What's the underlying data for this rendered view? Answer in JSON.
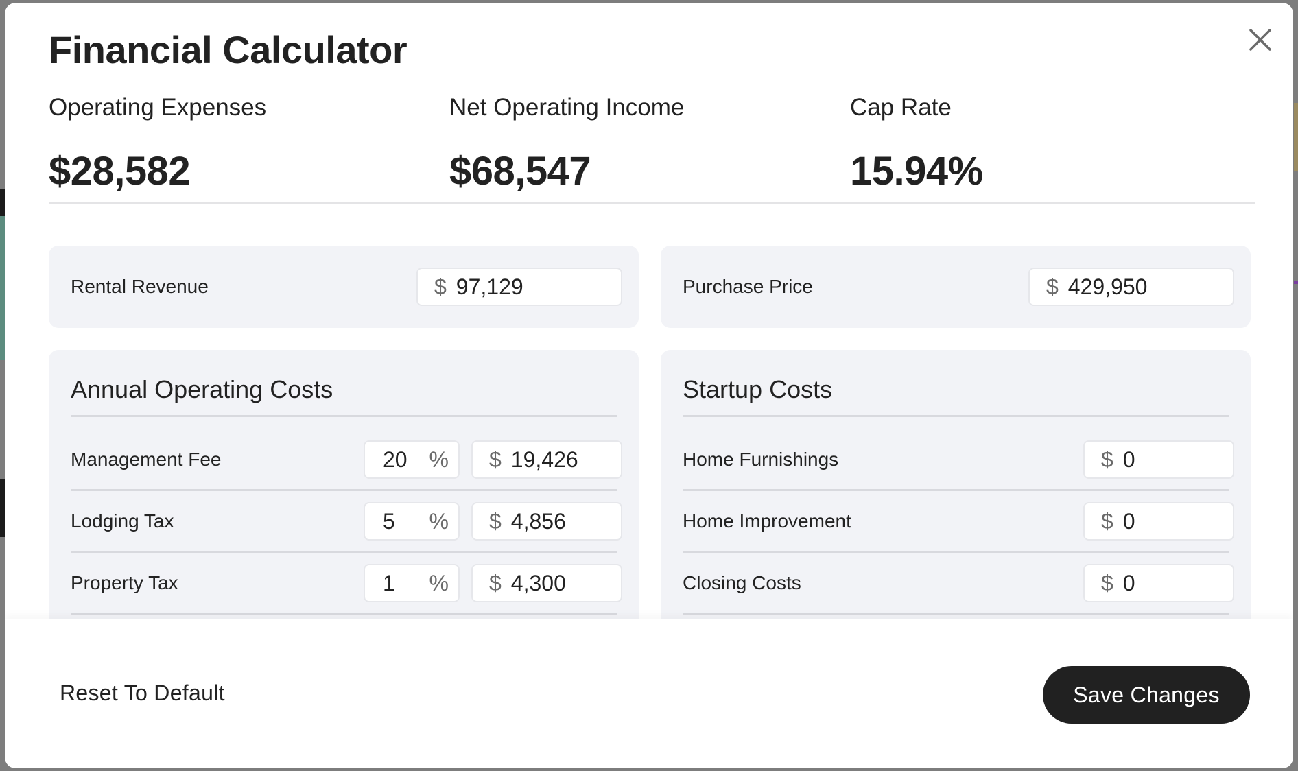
{
  "modal": {
    "title": "Financial Calculator",
    "close_icon": "close-icon"
  },
  "stats": [
    {
      "label": "Operating Expenses",
      "value": "$28,582"
    },
    {
      "label": "Net Operating Income",
      "value": "$68,547"
    },
    {
      "label": "Cap Rate",
      "value": "15.94%"
    }
  ],
  "top_inputs": {
    "rental_revenue": {
      "label": "Rental Revenue",
      "prefix": "$",
      "value": "97,129"
    },
    "purchase_price": {
      "label": "Purchase Price",
      "prefix": "$",
      "value": "429,950"
    }
  },
  "annual_operating_costs": {
    "title": "Annual Operating Costs",
    "rows": [
      {
        "label": "Management Fee",
        "percent": "20",
        "percent_suffix": "%",
        "prefix": "$",
        "amount": "19,426"
      },
      {
        "label": "Lodging Tax",
        "percent": "5",
        "percent_suffix": "%",
        "prefix": "$",
        "amount": "4,856"
      },
      {
        "label": "Property Tax",
        "percent": "1",
        "percent_suffix": "%",
        "prefix": "$",
        "amount": "4,300"
      }
    ]
  },
  "startup_costs": {
    "title": "Startup Costs",
    "rows": [
      {
        "label": "Home Furnishings",
        "prefix": "$",
        "amount": "0"
      },
      {
        "label": "Home Improvement",
        "prefix": "$",
        "amount": "0"
      },
      {
        "label": "Closing Costs",
        "prefix": "$",
        "amount": "0"
      }
    ]
  },
  "footer": {
    "reset_label": "Reset To Default",
    "save_label": "Save Changes"
  },
  "colors": {
    "primary_button": "#212121",
    "panel_background": "#f2f3f7",
    "text": "#222222"
  }
}
